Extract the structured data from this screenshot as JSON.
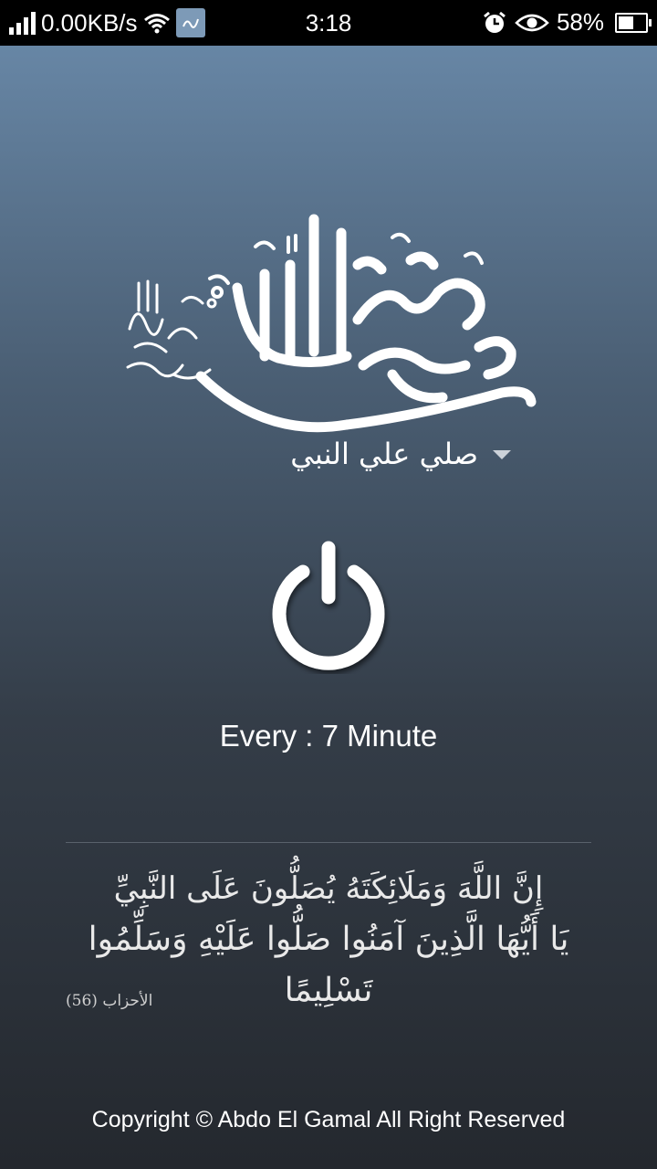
{
  "statusbar": {
    "network_speed": "0.00KB/s",
    "time": "3:18",
    "battery_percent": "58%",
    "battery_level": 0.58,
    "icons": [
      "signal-icon",
      "wifi-icon",
      "app-notification-icon",
      "alarm-icon",
      "eye-icon",
      "battery-icon"
    ]
  },
  "header": {
    "calligraphy_icon": "muhammad-rasul-allah-calligraphy"
  },
  "selector": {
    "value": "صلي علي النبي"
  },
  "power": {
    "icon": "power-icon"
  },
  "interval": {
    "text": "Every : 7 Minute"
  },
  "verse": {
    "line1": "إِنَّ اللَّهَ وَمَلَائِكَتَهُ يُصَلُّونَ عَلَى النَّبِيِّ",
    "line2": "يَا أَيُّهَا الَّذِينَ آمَنُوا صَلُّوا عَلَيْهِ وَسَلِّمُوا تَسْلِيمًا",
    "reference": "الأحزاب (56)"
  },
  "footer": {
    "copyright": "Copyright © Abdo El Gamal All Right Reserved"
  },
  "colors": {
    "gradient_top": "#6786a5",
    "gradient_bottom": "#24282e",
    "text": "#ffffff"
  }
}
